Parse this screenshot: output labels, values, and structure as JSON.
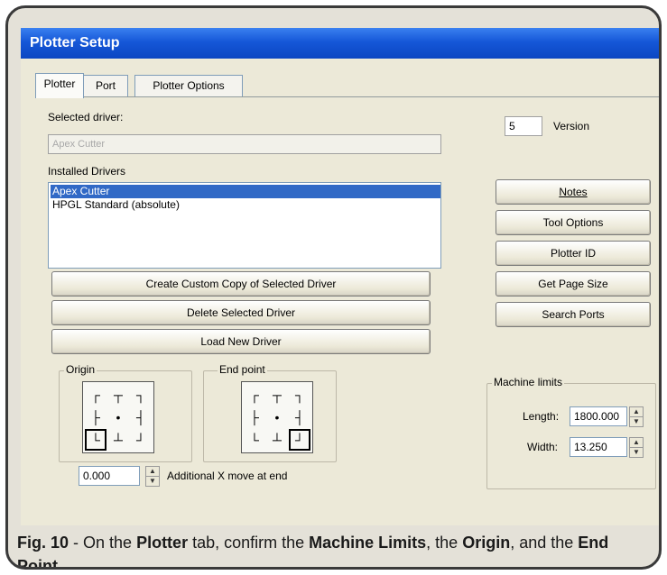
{
  "window": {
    "title": "Plotter Setup"
  },
  "tabs": [
    {
      "label": "Plotter"
    },
    {
      "label": "Port"
    },
    {
      "label": "Plotter Options"
    }
  ],
  "selected_driver": {
    "label": "Selected driver:",
    "value": "Apex Cutter"
  },
  "version": {
    "value": "5",
    "label": "Version"
  },
  "installed_drivers": {
    "label": "Installed Drivers",
    "items": [
      {
        "label": "Apex Cutter"
      },
      {
        "label": "HPGL Standard (absolute)"
      }
    ]
  },
  "driver_buttons": {
    "create_copy": "Create Custom Copy of Selected Driver",
    "delete": "Delete Selected Driver",
    "load": "Load New Driver"
  },
  "side_buttons": {
    "notes": "Notes",
    "tool_options": "Tool Options",
    "plotter_id": "Plotter ID",
    "get_page_size": "Get Page Size",
    "search_ports": "Search Ports"
  },
  "origin": {
    "label": "Origin"
  },
  "end_point": {
    "label": "End point"
  },
  "additional_move": {
    "value": "0.000",
    "label": "Additional X move at end"
  },
  "machine_limits": {
    "label": "Machine limits",
    "length_label": "Length:",
    "length_value": "1800.000",
    "width_label": "Width:",
    "width_value": "13.250"
  },
  "caption": {
    "fig": "Fig. 10",
    "t1": " - On the ",
    "b1": "Plotter",
    "t2": " tab, confirm the ",
    "b2": "Machine Limits",
    "t3": ", the ",
    "b3": "Origin",
    "t4": ", and the ",
    "b4": "End Point",
    "t5": "."
  },
  "colors": {
    "titlebar": "#1557d8",
    "selection": "#3169c6",
    "window_bg": "#ece9d8"
  }
}
